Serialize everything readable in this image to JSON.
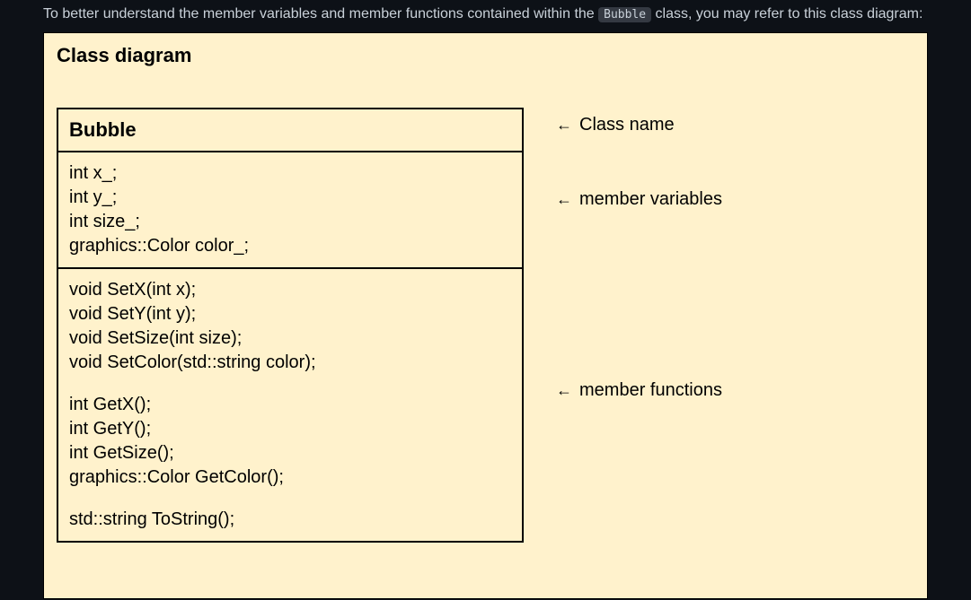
{
  "intro": {
    "prefix": "To better understand the member variables and member functions contained within the ",
    "code": "Bubble",
    "suffix": " class, you may refer to this class diagram:"
  },
  "diagram": {
    "title": "Class diagram",
    "className": "Bubble",
    "variables": [
      "int x_;",
      "int y_;",
      "int size_;",
      "graphics::Color color_;"
    ],
    "functions_group1": [
      "void SetX(int x);",
      "void SetY(int y);",
      "void SetSize(int size);",
      "void SetColor(std::string color);"
    ],
    "functions_group2": [
      "int GetX();",
      "int GetY();",
      "int GetSize();",
      "graphics::Color GetColor();"
    ],
    "functions_group3": [
      "std::string ToString();"
    ],
    "annotations": {
      "arrow": "←",
      "className": "Class name",
      "memberVars": "member variables",
      "memberFuncs": "member functions"
    }
  }
}
